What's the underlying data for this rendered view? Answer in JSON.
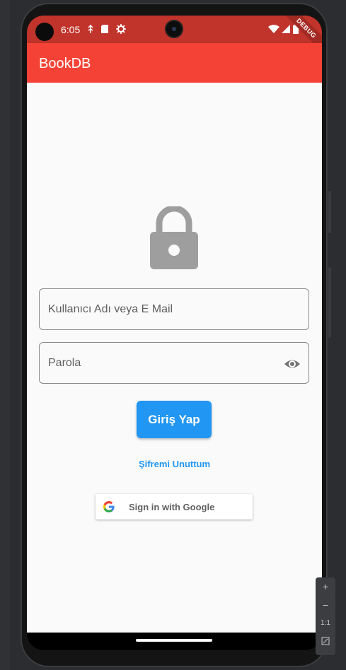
{
  "status_bar": {
    "time": "6:05"
  },
  "debug_banner": "DEBUG",
  "app_bar": {
    "title": "BookDB"
  },
  "login": {
    "username_placeholder": "Kullanıcı Adı veya E Mail",
    "password_placeholder": "Parola",
    "login_button": "Giriş Yap",
    "forgot_password": "Şifremi Unuttum",
    "google_button": "Sign in with Google"
  },
  "emulator_zoom": {
    "zoom_in": "+",
    "zoom_out": "−",
    "actual_size": "1:1"
  },
  "colors": {
    "app_bar": "#f44336",
    "status_bar": "#c0342b",
    "primary_button": "#2196f3",
    "lock_icon": "#9e9e9e"
  },
  "icons": [
    "lock-icon",
    "eye-icon",
    "google-logo-icon",
    "wifi-icon",
    "signal-icon",
    "battery-icon",
    "sd-card-icon",
    "settings-icon",
    "usb-icon"
  ]
}
